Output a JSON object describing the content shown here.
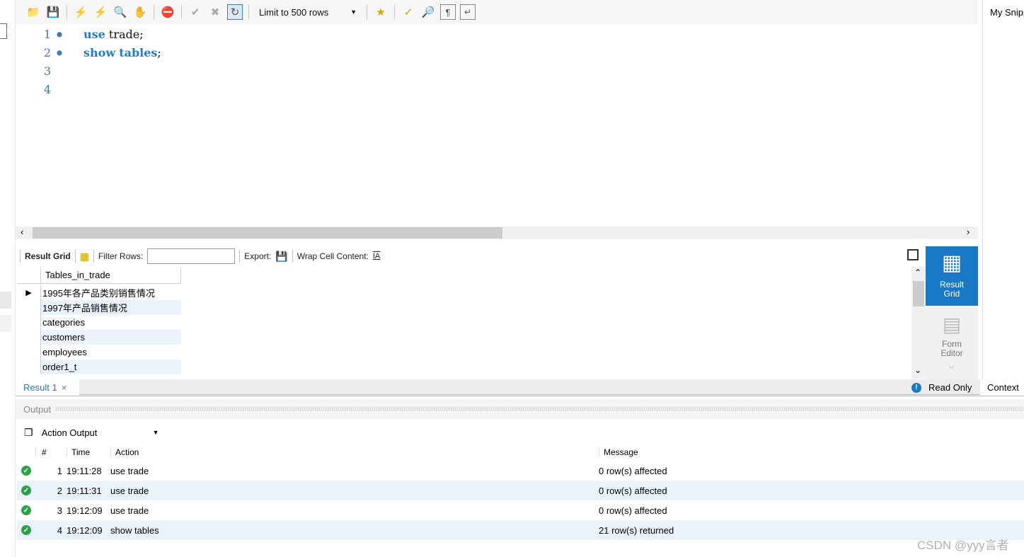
{
  "toolbar": {
    "icons": [
      "open-file-icon",
      "save-icon",
      "execute-icon",
      "execute-current-icon",
      "explain-icon",
      "stop-icon",
      "toggle-continue-icon",
      "commit-icon",
      "rollback-icon",
      "autocommit-icon",
      "beautify-icon",
      "find-icon",
      "invisible-chars-icon",
      "wrap-icon"
    ],
    "limit_label": "Limit to 500 rows"
  },
  "snippets": {
    "label": "My Snipp"
  },
  "editor": {
    "lines": [
      {
        "num": "1",
        "kw1": "use",
        "rest": "trade;"
      },
      {
        "num": "2",
        "kw1": "show",
        "kw2": "tables",
        "rest": ";"
      },
      {
        "num": "3"
      },
      {
        "num": "4"
      }
    ]
  },
  "result_toolbar": {
    "result_grid_label": "Result Grid",
    "filter_label": "Filter Rows:",
    "export_label": "Export:",
    "wrap_label": "Wrap Cell Content:"
  },
  "grid": {
    "column": "Tables_in_trade",
    "rows": [
      "1995年各产品类别销售情况",
      "1997年产品销售情况",
      "categories",
      "customers",
      "employees",
      "order1_t"
    ]
  },
  "side_buttons": {
    "result_grid": [
      "Result",
      "Grid"
    ],
    "form_editor": [
      "Form",
      "Editor"
    ]
  },
  "result_tabs": {
    "tab": "Result 1",
    "read_only": "Read Only",
    "context": "Context"
  },
  "output": {
    "title": "Output",
    "mode": "Action Output",
    "headers": {
      "num": "#",
      "time": "Time",
      "action": "Action",
      "message": "Message"
    },
    "rows": [
      {
        "num": "1",
        "time": "19:11:28",
        "action": "use trade",
        "message": "0 row(s) affected"
      },
      {
        "num": "2",
        "time": "19:11:31",
        "action": "use trade",
        "message": "0 row(s) affected"
      },
      {
        "num": "3",
        "time": "19:12:09",
        "action": "use trade",
        "message": "0 row(s) affected"
      },
      {
        "num": "4",
        "time": "19:12:09",
        "action": "show tables",
        "message": "21 row(s) returned"
      }
    ]
  },
  "watermark": "CSDN @yyy言者",
  "colors": {
    "accent": "#1a79c7",
    "keyword": "#1e7ec8",
    "ok": "#2ba245",
    "alt_row": "#eaf2fb"
  }
}
